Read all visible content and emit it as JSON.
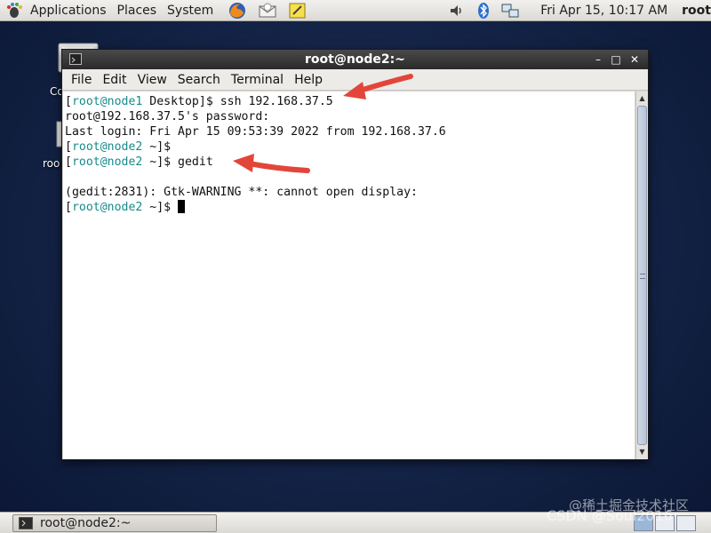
{
  "top_panel": {
    "menus": [
      "Applications",
      "Places",
      "System"
    ],
    "clock": "Fri Apr 15, 10:17 AM",
    "user": "root"
  },
  "desktop": {
    "icon_labels": [
      "Co",
      "roo"
    ]
  },
  "window": {
    "title": "root@node2:~",
    "menu": [
      "File",
      "Edit",
      "View",
      "Search",
      "Terminal",
      "Help"
    ]
  },
  "terminal": {
    "lines": [
      {
        "open": "[",
        "host": "root@node1",
        "after": " Desktop]$ ssh 192.168.37.5"
      },
      {
        "text": "root@192.168.37.5's password:"
      },
      {
        "text": "Last login: Fri Apr 15 09:53:39 2022 from 192.168.37.6"
      },
      {
        "open": "[",
        "host": "root@node2",
        "after": " ~]$"
      },
      {
        "open": "[",
        "host": "root@node2",
        "after": " ~]$ gedit"
      },
      {
        "text": ""
      },
      {
        "text": "(gedit:2831): Gtk-WARNING **: cannot open display:"
      },
      {
        "open": "[",
        "host": "root@node2",
        "after": " ~]$ ",
        "cursor": true
      }
    ]
  },
  "taskbar": {
    "task_label": "root@node2:~"
  },
  "watermark": {
    "line1": "@稀土掘金技术社区",
    "line2": "CSDN @Soul2016"
  },
  "colors": {
    "prompt_host": "#178a8a",
    "arrow": "#e2463a"
  }
}
